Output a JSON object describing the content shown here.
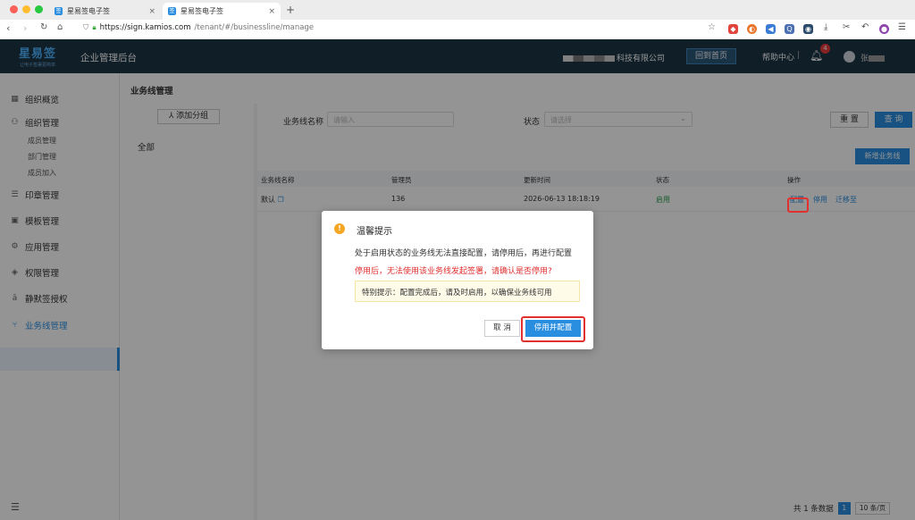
{
  "browser": {
    "tabs": [
      {
        "favicon": "签",
        "title": "星易签电子签"
      },
      {
        "favicon": "签",
        "title": "星易签电子签"
      }
    ],
    "url_host": "https://sign.kamios.com",
    "url_path": "/tenant/#/businessline/manage"
  },
  "header": {
    "logo_main": "星易签",
    "logo_sub": "让电子签署更简单",
    "system_name": "企业管理后台",
    "company_suffix": "科技有限公司",
    "home_button": "回到首页",
    "help": "帮助中心",
    "separator": "|",
    "notification_count": "4",
    "user_initial": "张"
  },
  "sidebar": {
    "items": [
      {
        "label": "组织概览",
        "icon": "grid-icon"
      },
      {
        "label": "组织管理",
        "icon": "org-icon"
      },
      {
        "label": "成员管理"
      },
      {
        "label": "部门管理"
      },
      {
        "label": "成员加入"
      },
      {
        "label": "印章管理",
        "icon": "seal-icon"
      },
      {
        "label": "模板管理",
        "icon": "template-icon"
      },
      {
        "label": "应用管理",
        "icon": "app-icon"
      },
      {
        "label": "权限管理",
        "icon": "permission-icon"
      },
      {
        "label": "静默签授权",
        "icon": "silent-sign-icon"
      },
      {
        "label": "业务线管理",
        "icon": "branch-icon"
      }
    ]
  },
  "page": {
    "title": "业务线管理",
    "add_group": "添加分组",
    "all_group": "全部"
  },
  "filters": {
    "name_label": "业务线名称",
    "name_placeholder": "请输入",
    "status_label": "状态",
    "status_placeholder": "请选择",
    "reset": "重 置",
    "query": "查 询",
    "add": "新增业务线"
  },
  "table": {
    "headers": [
      "业务线名称",
      "管理员",
      "更新时间",
      "状态",
      "操作"
    ],
    "rows": [
      {
        "name": "默认",
        "admin": "136",
        "updated": "2026-06-13 18:18:19",
        "status": "启用",
        "ops": [
          "配置",
          "停用",
          "迁移至"
        ]
      }
    ]
  },
  "pagination": {
    "total": "共 1 条数据",
    "page": "1",
    "size": "10 条/页"
  },
  "modal": {
    "title": "温馨提示",
    "line1": "处于启用状态的业务线无法直接配置，请停用后，再进行配置",
    "line2": "停用后，无法使用该业务线发起签署，请确认是否停用?",
    "tip": "特别提示：配置完成后，请及时启用，以确保业务线可用",
    "cancel": "取 消",
    "confirm": "停用并配置"
  },
  "colors": {
    "primary": "#2a8ee0",
    "header_bg": "#1d3445",
    "danger": "#e03030",
    "warning": "#f5a623"
  }
}
